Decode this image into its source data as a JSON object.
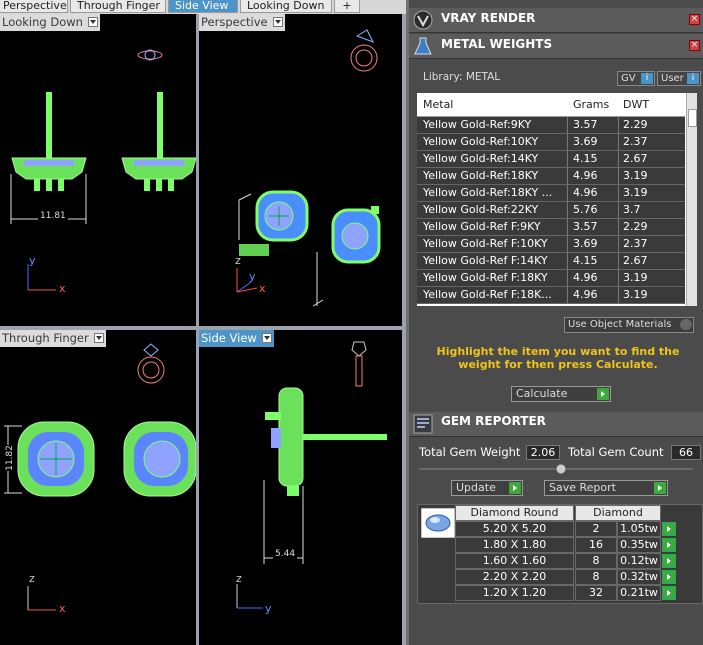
{
  "tabs": [
    {
      "label": "Perspective"
    },
    {
      "label": "Through Finger"
    },
    {
      "label": "Side View",
      "active": true
    },
    {
      "label": "Looking Down"
    },
    {
      "label": "+"
    }
  ],
  "viewports": {
    "top_left": {
      "label": "Looking Down",
      "dimension": "11.81",
      "axis1": "y",
      "axis2": "x"
    },
    "top_right": {
      "label": "Perspective",
      "axis1": "z",
      "axis2": "y",
      "axis3": "x"
    },
    "bottom_left": {
      "label": "Through Finger",
      "dimension": "11.82",
      "axis1": "z",
      "axis2": "x"
    },
    "bottom_right": {
      "label": "Side View",
      "dimension": "5.44",
      "axis1": "z",
      "axis2": "y"
    }
  },
  "vray": {
    "title": "VRAY RENDER"
  },
  "metal": {
    "title": "METAL WEIGHTS",
    "library_label": "Library: METAL",
    "gv_label": "GV",
    "user_label": "User",
    "info_glyph": "i",
    "columns": [
      "Metal",
      "Grams",
      "DWT"
    ],
    "rows": [
      [
        "Yellow Gold-Ref:9KY",
        "3.57",
        "2.29"
      ],
      [
        "Yellow Gold-Ref:10KY",
        "3.69",
        "2.37"
      ],
      [
        "Yellow Gold-Ref:14KY",
        "4.15",
        "2.67"
      ],
      [
        "Yellow Gold-Ref:18KY",
        "4.96",
        "3.19"
      ],
      [
        "Yellow Gold-Ref:18KY ...",
        "4.96",
        "3.19"
      ],
      [
        "Yellow Gold-Ref:22KY",
        "5.76",
        "3.7"
      ],
      [
        "Yellow Gold-Ref F:9KY",
        "3.57",
        "2.29"
      ],
      [
        "Yellow Gold-Ref F:10KY",
        "3.69",
        "2.37"
      ],
      [
        "Yellow Gold-Ref F:14KY",
        "4.15",
        "2.67"
      ],
      [
        "Yellow Gold-Ref F:18KY",
        "4.96",
        "3.19"
      ],
      [
        "Yellow Gold-Ref F:18K...",
        "4.96",
        "3.19"
      ]
    ],
    "use_object_materials": "Use Object Materials",
    "hint": "Highlight the item you want to find the weight for then press Calculate.",
    "calculate": "Calculate"
  },
  "gem": {
    "title": "GEM REPORTER",
    "total_weight_label": "Total Gem Weight",
    "total_weight": "2.06",
    "total_count_label": "Total Gem Count",
    "total_count": "66",
    "update": "Update",
    "save_report": "Save Report",
    "header_shape": "Diamond Round",
    "header_type": "Diamond",
    "rows": [
      [
        "5.20 X 5.20",
        "2",
        "1.05tw"
      ],
      [
        "1.80 X 1.80",
        "16",
        "0.35tw"
      ],
      [
        "1.60 X 1.60",
        "8",
        "0.12tw"
      ],
      [
        "2.20 X 2.20",
        "8",
        "0.32tw"
      ],
      [
        "1.20 X 1.20",
        "32",
        "0.21tw"
      ]
    ]
  },
  "colors": {
    "accent": "#4d94c9",
    "wire_green": "#7dff6a",
    "wire_blue": "#7f9cff",
    "hint_yellow": "#f0c419",
    "go_green": "#3ea83e"
  }
}
